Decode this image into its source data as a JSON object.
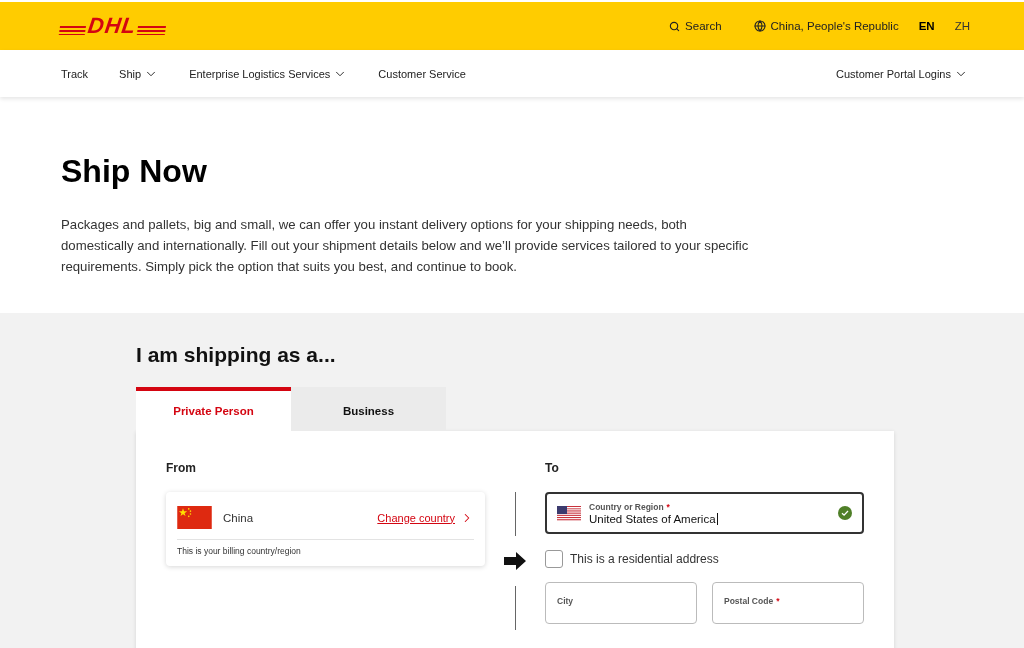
{
  "header": {
    "logo": "DHL",
    "search": "Search",
    "region": "China, People's Republic",
    "languages": [
      {
        "code": "EN",
        "selected": true
      },
      {
        "code": "ZH",
        "selected": false
      }
    ]
  },
  "nav": {
    "items": [
      {
        "label": "Track",
        "has_menu": false
      },
      {
        "label": "Ship",
        "has_menu": true
      },
      {
        "label": "Enterprise Logistics Services",
        "has_menu": true
      },
      {
        "label": "Customer Service",
        "has_menu": false
      }
    ],
    "right_item": {
      "label": "Customer Portal Logins",
      "has_menu": true
    }
  },
  "intro": {
    "title": "Ship Now",
    "text": "Packages and pallets, big and small, we can offer you instant delivery options for your shipping needs, both domestically and internationally. Fill out your shipment details below and we’ll provide services tailored to your specific requirements. Simply pick the option that suits you best, and continue to book."
  },
  "shipping": {
    "heading": "I am shipping as a...",
    "tabs": [
      {
        "label": "Private Person",
        "selected": true
      },
      {
        "label": "Business",
        "selected": false
      }
    ],
    "from": {
      "heading": "From",
      "country": "China",
      "change_link": "Change country",
      "note": "This is your billing country/region"
    },
    "to": {
      "heading": "To",
      "country_field": {
        "label": "Country or Region",
        "required_mark": "*",
        "value": "United States of America",
        "focused": true,
        "valid": true
      },
      "residential": {
        "label": "This is a residential address",
        "checked": false
      },
      "fields": [
        {
          "label": "City"
        },
        {
          "label": "Postal Code",
          "required_mark": "*"
        }
      ]
    }
  }
}
